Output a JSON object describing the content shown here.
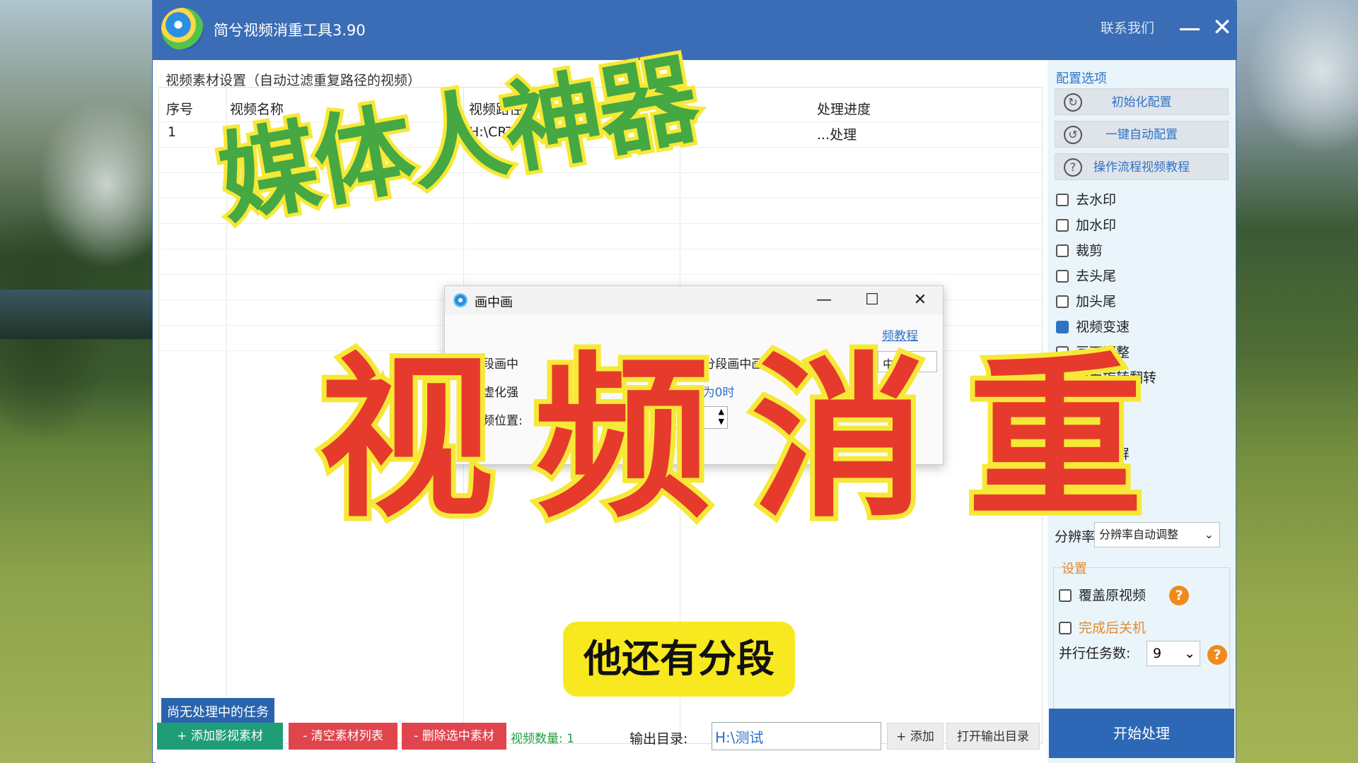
{
  "window": {
    "title": "简兮视频消重工具3.90",
    "contact_label": "联系我们"
  },
  "materials": {
    "legend": "视频素材设置（自动过滤重复路径的视频）",
    "columns": [
      "序号",
      "视频名称",
      "视频路径",
      "处理进度"
    ],
    "rows": [
      {
        "index": "1",
        "name": "1",
        "path": "H:\\CRT...eGet D...",
        "progress": "...处理"
      }
    ]
  },
  "bottom": {
    "task_status": "尚无处理中的任务",
    "add_material": "+ 添加影视素材",
    "clear_list": "- 清空素材列表",
    "delete_selected": "- 删除选中素材",
    "video_count": "视频数量: 1",
    "output_label": "输出目录:",
    "output_value": "H:\\测试",
    "add_label": "+ 添加",
    "open_output": "打开输出目录"
  },
  "config": {
    "title": "配置选项",
    "init_config": "初始化配置",
    "auto_config": "一键自动配置",
    "tutorial": "操作流程视频教程",
    "options": [
      "去水印",
      "加水印",
      "裁剪",
      "去头尾",
      "加头尾",
      "视频变速",
      "画面调整",
      "画面旋转翻转",
      "抽帧",
      "画中画",
      "宫格分屏",
      "背景音乐",
      "声音变调"
    ],
    "resolution_label": "分辨率",
    "resolution_value": "分辨率自动调整"
  },
  "settings": {
    "title": "设置",
    "overwrite": "覆盖原视频",
    "shutdown": "完成后关机",
    "parallel_label": "并行任务数:",
    "parallel_value": "9",
    "start": "开始处理"
  },
  "dialog": {
    "title": "画中画",
    "tutorial_link": "频教程",
    "segment_label": "分段画中",
    "segment_label2": "一段  分段画中画",
    "mode_value": "中画",
    "blur_label": "景虚化强",
    "blur_hint": "10，为0时",
    "position_label": "视频位置:",
    "position_value": "50"
  },
  "overlay": {
    "line1": "媒体人神器",
    "line2": "视频消重",
    "caption": "他还有分段"
  },
  "colors": {
    "title_bar": "#3a6db6",
    "accent": "#2f72c4",
    "green_button": "#1f9d77",
    "red_button": "#e0454e"
  }
}
